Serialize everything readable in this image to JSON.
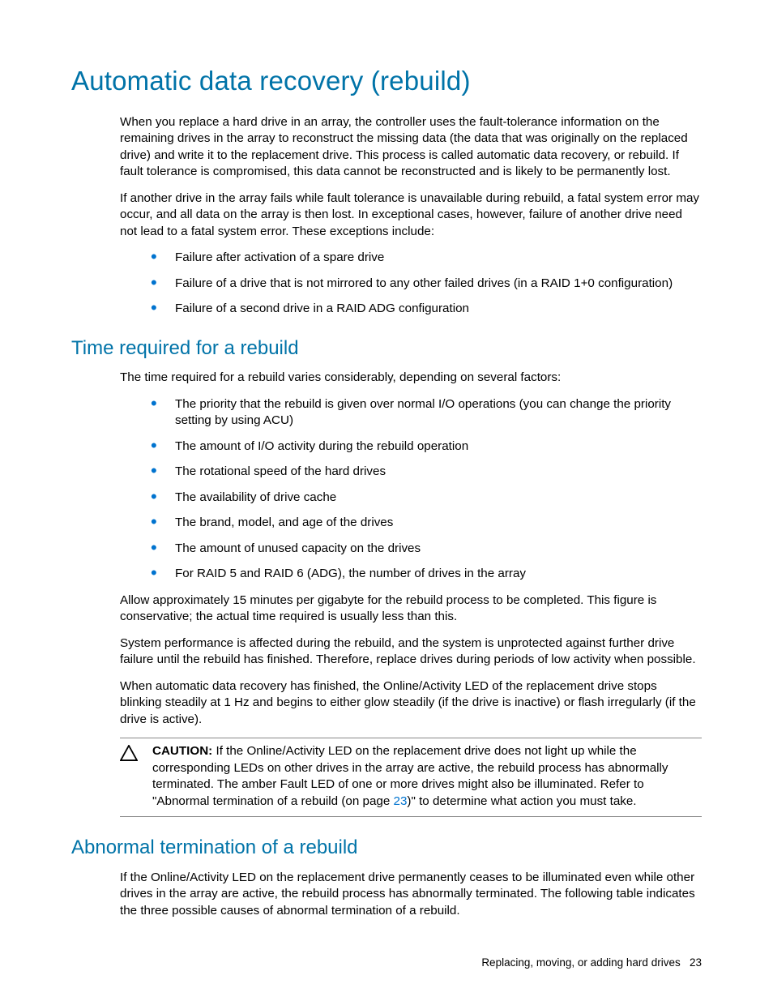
{
  "page": {
    "footer_text": "Replacing, moving, or adding hard drives",
    "footer_page": "23"
  },
  "h1": "Automatic data recovery (rebuild)",
  "intro_p1": "When you replace a hard drive in an array, the controller uses the fault-tolerance information on the remaining drives in the array to reconstruct the missing data (the data that was originally on the replaced drive) and write it to the replacement drive. This process is called automatic data recovery, or rebuild. If fault tolerance is compromised, this data cannot be reconstructed and is likely to be permanently lost.",
  "intro_p2": "If another drive in the array fails while fault tolerance is unavailable during rebuild, a fatal system error may occur, and all data on the array is then lost. In exceptional cases, however, failure of another drive need not lead to a fatal system error. These exceptions include:",
  "intro_bullets": [
    "Failure after activation of a spare drive",
    "Failure of a drive that is not mirrored to any other failed drives (in a RAID 1+0 configuration)",
    "Failure of a second drive in a RAID ADG configuration"
  ],
  "time": {
    "heading": "Time required for a rebuild",
    "lead": "The time required for a rebuild varies considerably, depending on several factors:",
    "bullets": [
      "The priority that the rebuild is given over normal I/O operations (you can change the priority setting by using ACU)",
      "The amount of I/O activity during the rebuild operation",
      "The rotational speed of the hard drives",
      "The availability of drive cache",
      "The brand, model, and age of the drives",
      "The amount of unused capacity on the drives",
      "For RAID 5 and RAID 6 (ADG), the number of drives in the array"
    ],
    "p_after1": "Allow approximately 15 minutes per gigabyte for the rebuild process to be completed. This figure is conservative; the actual time required is usually less than this.",
    "p_after2": "System performance is affected during the rebuild, and the system is unprotected against further drive failure until the rebuild has finished. Therefore, replace drives during periods of low activity when possible.",
    "p_after3": "When automatic data recovery has finished, the Online/Activity LED of the replacement drive stops blinking steadily at 1 Hz and begins to either glow steadily (if the drive is inactive) or flash irregularly (if the drive is active).",
    "caution_label": "CAUTION:",
    "caution_body_1": "  If the Online/Activity LED on the replacement drive does not light up while the corresponding LEDs on other drives in the array are active, the rebuild process has abnormally terminated. The amber Fault LED of one or more drives might also be illuminated. Refer to \"Abnormal termination of a rebuild (on page ",
    "caution_link": "23",
    "caution_body_2": ")\" to determine what action you must take."
  },
  "abnormal": {
    "heading": "Abnormal termination of a rebuild",
    "p1": "If the Online/Activity LED on the replacement drive permanently ceases to be illuminated even while other drives in the array are active, the rebuild process has abnormally terminated. The following table indicates the three possible causes of abnormal termination of a rebuild."
  }
}
